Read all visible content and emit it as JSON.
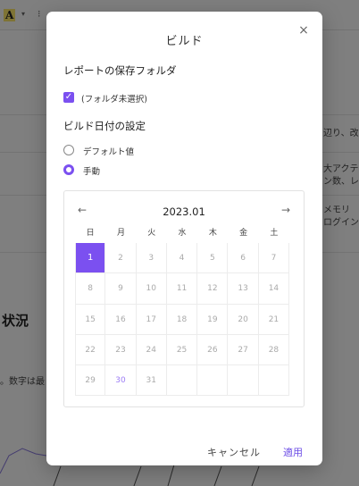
{
  "background": {
    "toolbar": {
      "format_letter": "A",
      "caret": "▾",
      "menu": "⁝"
    },
    "right_texts": [
      "辺り、改善",
      "大アクティ",
      "ン数、レス",
      "メモリ",
      "ログイン、"
    ],
    "heading": "状況",
    "note": "。数字は最"
  },
  "dialog": {
    "title": "ビルド",
    "close_label": "×",
    "save_folder_label": "レポートの保存フォルダ",
    "folder_checkbox": {
      "checked": true,
      "label": "(フォルダ未選択)"
    },
    "build_date_label": "ビルド日付の設定",
    "radio_options": [
      {
        "label": "デフォルト値",
        "selected": false
      },
      {
        "label": "手動",
        "selected": true
      }
    ],
    "calendar": {
      "month_label": "2023.01",
      "prev": "←",
      "next": "→",
      "weekdays": [
        "日",
        "月",
        "火",
        "水",
        "木",
        "金",
        "土"
      ],
      "weeks": [
        [
          "1",
          "2",
          "3",
          "4",
          "5",
          "6",
          "7"
        ],
        [
          "8",
          "9",
          "10",
          "11",
          "12",
          "13",
          "14"
        ],
        [
          "15",
          "16",
          "17",
          "18",
          "19",
          "20",
          "21"
        ],
        [
          "22",
          "23",
          "24",
          "25",
          "26",
          "27",
          "28"
        ],
        [
          "29",
          "30",
          "31",
          "",
          "",
          "",
          ""
        ]
      ],
      "selected_day": "1",
      "highlighted_day": "30"
    },
    "cancel_label": "キャンセル",
    "apply_label": "適用"
  },
  "colors": {
    "accent": "#7b50f0",
    "apply_text": "#6b4ce6",
    "highlight_day": "#9d7ef5"
  }
}
